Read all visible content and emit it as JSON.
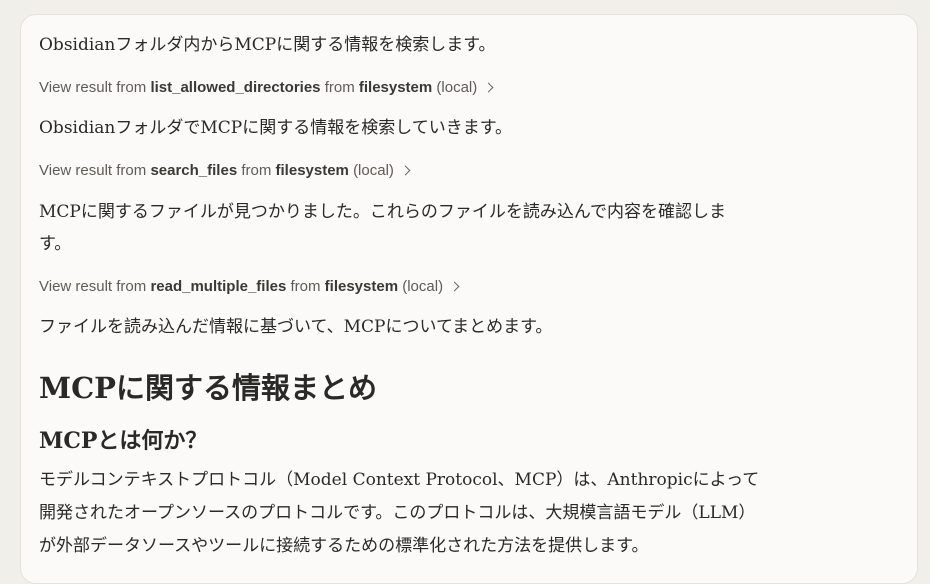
{
  "messages": {
    "intro": "Obsidianフォルダ内からMCPに関する情報を検索します。",
    "step2": "ObsidianフォルダでMCPに関する情報を検索していきます。",
    "step3_line1": "MCPに関するファイルが見つかりました。これらのファイルを読み込んで内容を確認しま",
    "step3_line2": "す。",
    "step4": "ファイルを読み込んだ情報に基づいて、MCPについてまとめます。"
  },
  "tool_results": [
    {
      "prefix": "View result from",
      "tool": "list_allowed_directories",
      "mid": "from",
      "server": "filesystem",
      "suffix": "(local)"
    },
    {
      "prefix": "View result from",
      "tool": "search_files",
      "mid": "from",
      "server": "filesystem",
      "suffix": "(local)"
    },
    {
      "prefix": "View result from",
      "tool": "read_multiple_files",
      "mid": "from",
      "server": "filesystem",
      "suffix": "(local)"
    }
  ],
  "summary": {
    "heading": "MCPに関する情報まとめ",
    "subheading": "MCPとは何か？",
    "body_line1": "モデルコンテキストプロトコル（Model Context Protocol、MCP）は、Anthropicによって",
    "body_line2": "開発されたオープンソースのプロトコルです。このプロトコルは、大規模言語モデル（LLM）",
    "body_line3": "が外部データソースやツールに接続するための標準化された方法を提供します。"
  }
}
